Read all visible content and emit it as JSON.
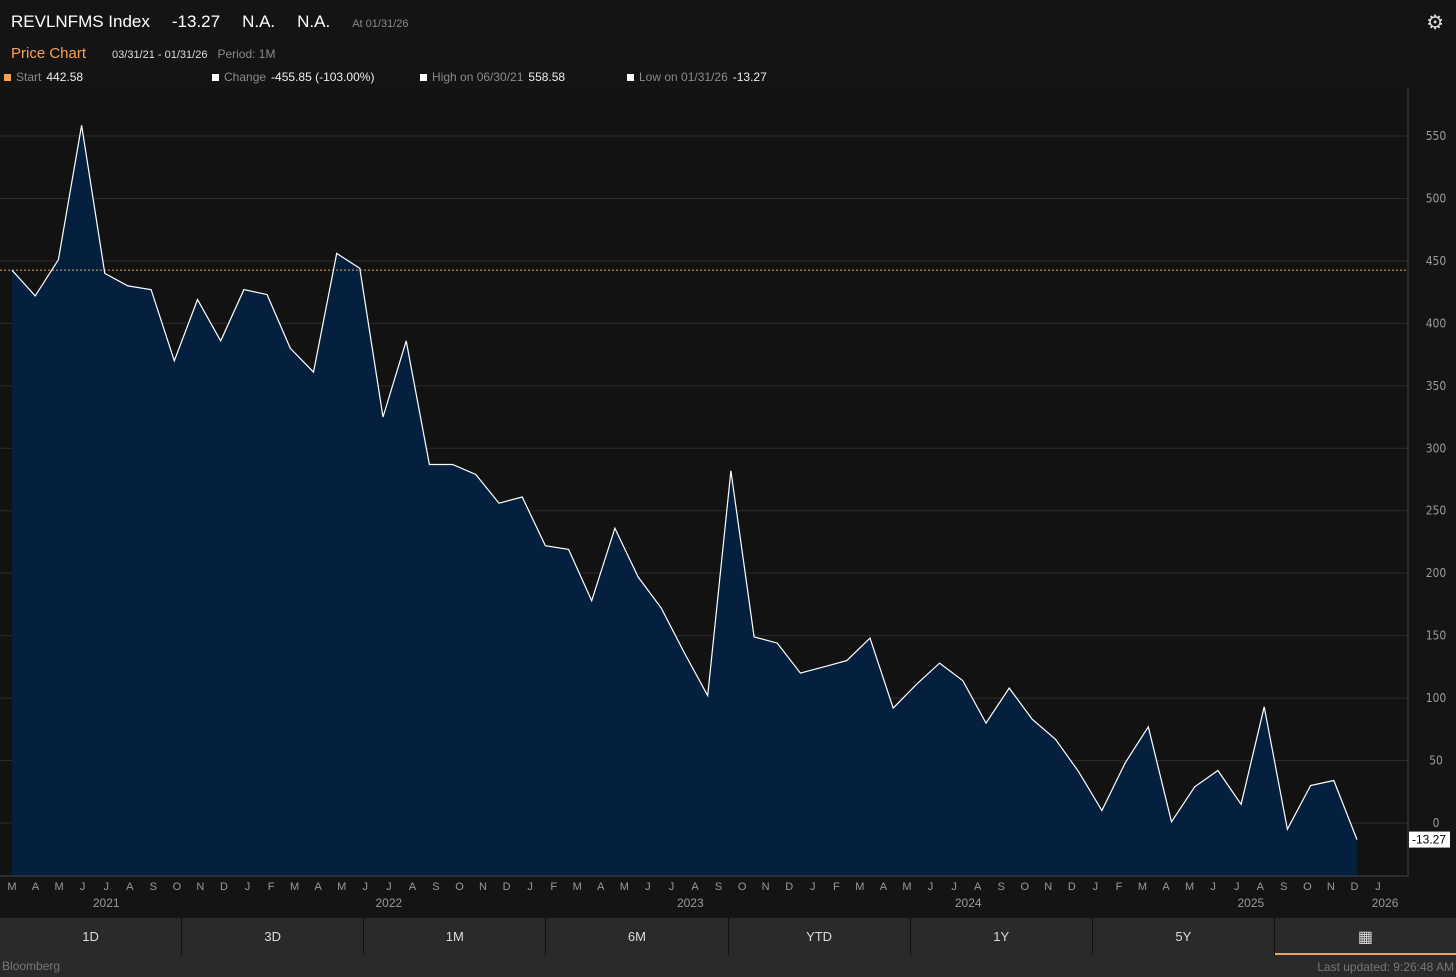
{
  "header": {
    "ticker": "REVLNFMS Index",
    "last": "-13.27",
    "field2": "N.A.",
    "field3": "N.A.",
    "as_of": "At 01/31/26"
  },
  "subheader": {
    "title": "Price Chart",
    "range": "03/31/21 - 01/31/26",
    "period": "Period: 1M"
  },
  "legend": [
    {
      "label": "Start",
      "value": "442.58",
      "color": "#f5a255"
    },
    {
      "label": "Change",
      "value": "-455.85 (-103.00%)",
      "color": "#ffffff"
    },
    {
      "label": "High on 06/30/21",
      "value": "558.58",
      "color": "#ffffff"
    },
    {
      "label": "Low on 01/31/26",
      "value": "-13.27",
      "color": "#ffffff"
    }
  ],
  "tabs": [
    "1D",
    "3D",
    "1M",
    "6M",
    "YTD",
    "1Y",
    "5Y"
  ],
  "footer": {
    "brand": "Bloomberg",
    "updated": "Last updated: 9:26:48 AM"
  },
  "colors": {
    "accent": "#f5a255",
    "fill": "#05203f",
    "line": "#ffffff"
  },
  "chart_data": {
    "type": "area",
    "ylim": [
      -40,
      600
    ],
    "yticks": [
      0,
      50,
      100,
      150,
      200,
      250,
      300,
      350,
      400,
      450,
      500,
      550
    ],
    "reference_line": 442.58,
    "last_label": "-13.27",
    "month_labels": [
      "M",
      "A",
      "M",
      "J",
      "J",
      "A",
      "S",
      "O",
      "N",
      "D",
      "J",
      "F",
      "M",
      "A",
      "M",
      "J",
      "J",
      "A",
      "S",
      "O",
      "N",
      "D",
      "J",
      "F",
      "M",
      "A",
      "M",
      "J",
      "J",
      "A",
      "S",
      "O",
      "N",
      "D",
      "J",
      "F",
      "M",
      "A",
      "M",
      "J",
      "J",
      "A",
      "S",
      "O",
      "N",
      "D",
      "J",
      "F",
      "M",
      "A",
      "M",
      "J",
      "J",
      "A",
      "S",
      "O",
      "N",
      "D",
      "J"
    ],
    "year_labels": [
      {
        "label": "2021",
        "month_index": 4
      },
      {
        "label": "2022",
        "month_index": 16
      },
      {
        "label": "2023",
        "month_index": 28.8
      },
      {
        "label": "2024",
        "month_index": 40.6
      },
      {
        "label": "2025",
        "month_index": 52.6
      },
      {
        "label": "2026",
        "month_index": 58.3
      }
    ],
    "values": [
      442.58,
      422,
      451,
      558.58,
      440,
      430,
      427,
      370,
      419,
      386,
      427,
      423,
      380,
      361,
      456,
      444,
      325,
      386,
      287,
      287,
      279,
      256,
      261,
      222,
      219,
      178,
      236,
      197,
      172,
      136,
      102,
      282,
      149,
      144,
      120,
      125,
      130,
      148,
      92,
      111,
      128,
      114,
      80,
      108,
      83,
      67,
      41,
      10,
      48,
      77,
      1,
      29,
      42,
      15,
      93,
      -5,
      30,
      34,
      -13.27
    ]
  }
}
